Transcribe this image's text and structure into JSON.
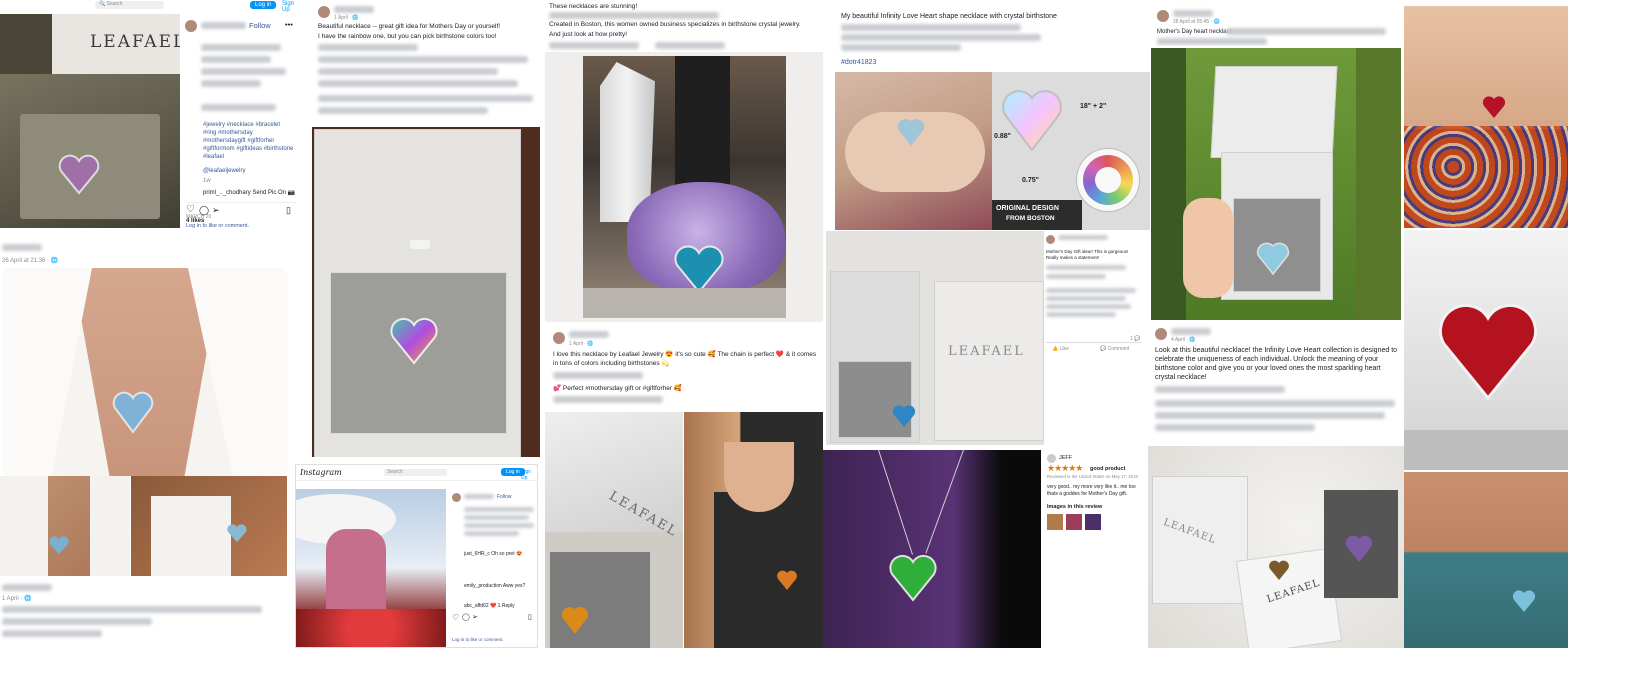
{
  "brand": {
    "name": "LEAFAEL",
    "colors": {
      "fb_blue": "#385898",
      "ig_blue": "#0095f6",
      "amazon_star": "#e77600"
    }
  },
  "tile_ig_left": {
    "follow": "Follow",
    "caption_tags": "#jewelry #necklace #bracelet #ring #mothersday #mothersdaygift #giftforher #giftformom #giftideas #birthstone #leafael",
    "mention": "@leafaeljewelry",
    "time_short": "1w",
    "comment_line": "priml_.._chodhary Send Pic On 📷",
    "likes": "4 likes",
    "likes_date": "MARCH 20",
    "login_prompt": "Log in to like or comment."
  },
  "tile_fb_date": {
    "date": "26 April at 21:36 · 🌐"
  },
  "tile_post_beautiful": {
    "time": "1 April · 🌐",
    "line1": "Beautiful necklace -- great gift idea for Mothers Day or yourself!",
    "line2": "I have the rainbow one, but you can pick birthstone colors too!"
  },
  "tile_boston": {
    "line_top": "These necklaces are stunning!",
    "line1": "Created in Boston, this women owned business specializes in birthstone crystal jewelry.",
    "line2": "And just look at how pretty!"
  },
  "tile_infinity_top": {
    "line1": "My beautiful Infinity Love Heart shape necklace with crystal birthstone",
    "hashtag": "#dotr41823"
  },
  "tile_size_chart": {
    "dim_chain": "18\" + 2\"",
    "dim_height": "0.88\"",
    "dim_width": "0.75\"",
    "origin_line1": "ORIGINAL DESIGN",
    "origin_line2": "FROM BOSTON"
  },
  "tile_mothers_day_top": {
    "time": "28 April at 05:45 · 🌐",
    "line1": "Mother's Day heart necklace."
  },
  "tile_love_necklace": {
    "time": "1 April · 🌐",
    "line1": "I love this necklace by Leafael Jewelry 😍 it's so cute 🥰 The chain is perfect ❤️ & it comes in tons of colors including birthstones 💫",
    "line2": "💕 Perfect #mothersday gift or #giftforher 🥰"
  },
  "tile_fb_small": {
    "line1": "Mother's Day Gift idea!! This is gorgeous! Really makes a statement!",
    "like": "Like",
    "comment": "Comment",
    "count": "1 💬"
  },
  "tile_infinity_collection": {
    "time": "4 April · 🌐",
    "text": "Look at this beautiful necklace! the Infinity Love Heart collection is designed to celebrate the uniqueness of each individual. Unlock the meaning of your birthstone color and give you or your loved ones the most sparkling heart crystal necklace!"
  },
  "tile_review": {
    "reviewer": "JEFF",
    "stars": "★★★★★",
    "title": "good product",
    "meta": "Reviewed in the United States on May 17, 2019",
    "body": "very good.. my more very like it.. me too thats a goddes for Mother's Day gift.",
    "images_label": "Images in this review"
  },
  "tile_ig_bottom": {
    "logo": "Instagram",
    "search_placeholder": "Search",
    "login": "Log in",
    "signup": "Sign Up",
    "follow": "Follow",
    "comment1": "just_6HR_c Oh so pret 😍",
    "comment2": "emily_production Aww yes?",
    "likes": "abc_affd62 ❤️ 1 Reply",
    "login_prompt": "Log in to like or comment."
  },
  "tile_fb_bottom_left": {
    "time": "1 April · 🌐"
  },
  "tile_ig_top_strip": {
    "search": "Search",
    "login": "Log in",
    "signup": "Sign Up"
  },
  "box_label": "LEAFAEL"
}
